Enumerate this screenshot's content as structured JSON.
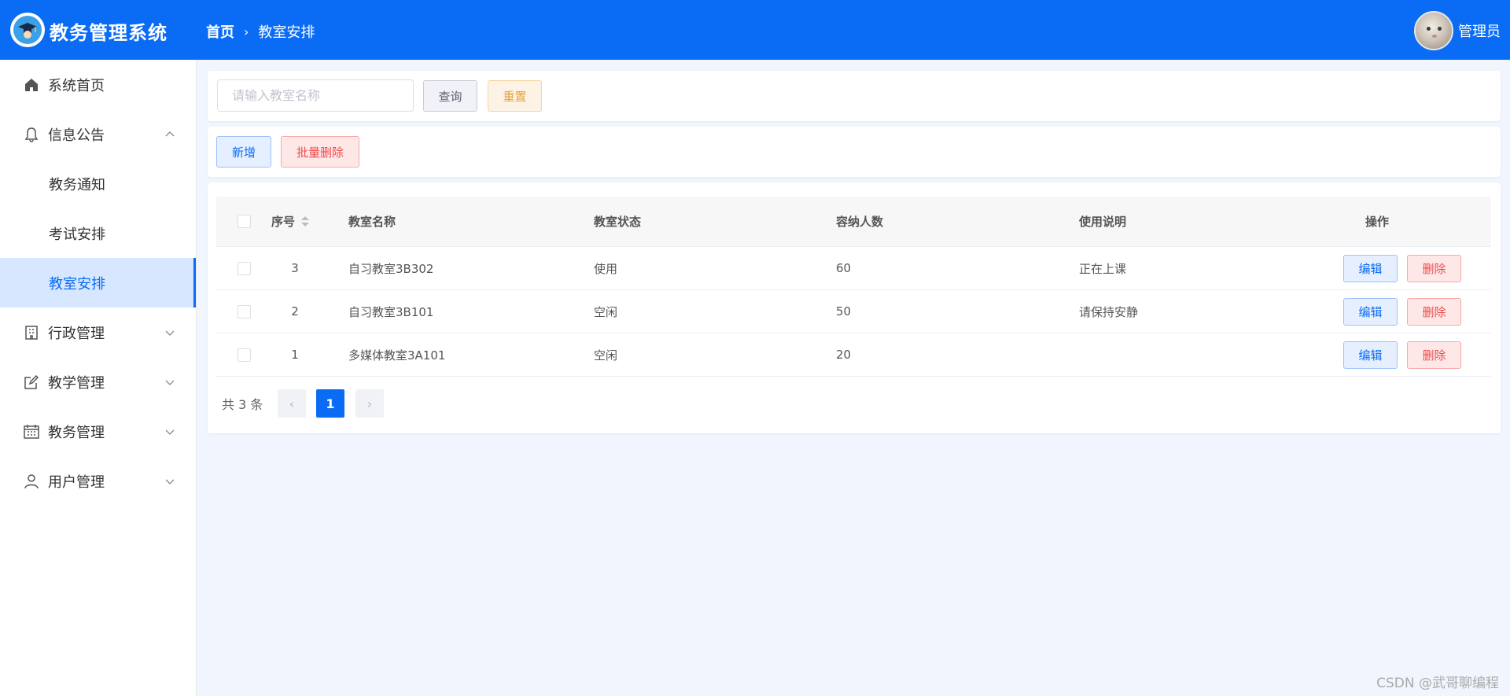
{
  "header": {
    "app_title": "教务管理系统",
    "breadcrumb_home": "首页",
    "breadcrumb_current": "教室安排",
    "user_name": "管理员",
    "bg_color": "#0a6cf5"
  },
  "sidebar": {
    "items": [
      {
        "label": "系统首页",
        "icon": "home-icon"
      },
      {
        "label": "信息公告",
        "icon": "bell-icon",
        "expanded": true
      },
      {
        "label": "教务通知"
      },
      {
        "label": "考试安排"
      },
      {
        "label": "教室安排",
        "active": true
      },
      {
        "label": "行政管理",
        "icon": "building-icon"
      },
      {
        "label": "教学管理",
        "icon": "edit-icon"
      },
      {
        "label": "教务管理",
        "icon": "calendar-icon"
      },
      {
        "label": "用户管理",
        "icon": "user-icon"
      }
    ]
  },
  "search": {
    "placeholder": "请输入教室名称",
    "value": "",
    "query_label": "查询",
    "reset_label": "重置"
  },
  "actions": {
    "add_label": "新增",
    "batch_delete_label": "批量删除"
  },
  "table": {
    "headers": [
      "序号",
      "教室名称",
      "教室状态",
      "容纳人数",
      "使用说明",
      "操作"
    ],
    "rows": [
      {
        "no": "3",
        "name": "自习教室3B302",
        "status": "使用",
        "capacity": "60",
        "desc": "正在上课"
      },
      {
        "no": "2",
        "name": "自习教室3B101",
        "status": "空闲",
        "capacity": "50",
        "desc": "请保持安静"
      },
      {
        "no": "1",
        "name": "多媒体教室3A101",
        "status": "空闲",
        "capacity": "20",
        "desc": ""
      }
    ],
    "edit_label": "编辑",
    "delete_label": "删除"
  },
  "pagination": {
    "total_text": "共 3 条",
    "current_page": "1",
    "prev": "‹",
    "next": "›"
  },
  "watermark": "CSDN @武哥聊编程"
}
